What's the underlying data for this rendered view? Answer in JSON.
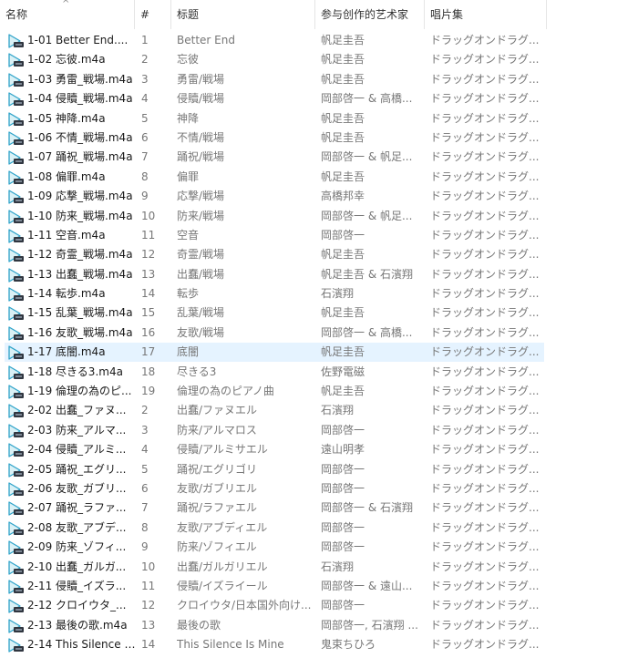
{
  "columns": {
    "name": "名称",
    "number": "#",
    "title": "标题",
    "artist": "参与创作的艺术家",
    "album": "唱片集"
  },
  "sort_indicator": "^",
  "icon": "audio-file-icon",
  "accent_color": "#e5f3ff",
  "selected_index": 16,
  "rows": [
    {
      "name": "1-01 Better End....",
      "num": "1",
      "title": "Better End",
      "artist": "帆足圭吾",
      "album": "ドラッグオンドラグ..."
    },
    {
      "name": "1-02 忘彼.m4a",
      "num": "2",
      "title": "忘彼",
      "artist": "帆足圭吾",
      "album": "ドラッグオンドラグ..."
    },
    {
      "name": "1-03 勇雷_戦場.m4a",
      "num": "3",
      "title": "勇雷/戦場",
      "artist": "帆足圭吾",
      "album": "ドラッグオンドラグ..."
    },
    {
      "name": "1-04 侵贖_戦場.m4a",
      "num": "4",
      "title": "侵贖/戦場",
      "artist": "岡部啓一 & 高橋...",
      "album": "ドラッグオンドラグ..."
    },
    {
      "name": "1-05 神降.m4a",
      "num": "5",
      "title": "神降",
      "artist": "帆足圭吾",
      "album": "ドラッグオンドラグ..."
    },
    {
      "name": "1-06 不情_戦場.m4a",
      "num": "6",
      "title": "不情/戦場",
      "artist": "帆足圭吾",
      "album": "ドラッグオンドラグ..."
    },
    {
      "name": "1-07 踊祝_戦場.m4a",
      "num": "7",
      "title": "踊祝/戦場",
      "artist": "岡部啓一 & 帆足...",
      "album": "ドラッグオンドラグ..."
    },
    {
      "name": "1-08 偏罪.m4a",
      "num": "8",
      "title": "偏罪",
      "artist": "帆足圭吾",
      "album": "ドラッグオンドラグ..."
    },
    {
      "name": "1-09 応撃_戦場.m4a",
      "num": "9",
      "title": "応撃/戦場",
      "artist": "高橋邦幸",
      "album": "ドラッグオンドラグ..."
    },
    {
      "name": "1-10 防来_戦場.m4a",
      "num": "10",
      "title": "防来/戦場",
      "artist": "岡部啓一 & 帆足...",
      "album": "ドラッグオンドラグ..."
    },
    {
      "name": "1-11 空音.m4a",
      "num": "11",
      "title": "空音",
      "artist": "岡部啓一",
      "album": "ドラッグオンドラグ..."
    },
    {
      "name": "1-12 奇霊_戦場.m4a",
      "num": "12",
      "title": "奇霊/戦場",
      "artist": "帆足圭吾",
      "album": "ドラッグオンドラグ..."
    },
    {
      "name": "1-13 出蠢_戦場.m4a",
      "num": "13",
      "title": "出蠢/戦場",
      "artist": "帆足圭吾 & 石濱翔",
      "album": "ドラッグオンドラグ..."
    },
    {
      "name": "1-14 転歩.m4a",
      "num": "14",
      "title": "転歩",
      "artist": "石濱翔",
      "album": "ドラッグオンドラグ..."
    },
    {
      "name": "1-15 乱葉_戦場.m4a",
      "num": "15",
      "title": "乱葉/戦場",
      "artist": "帆足圭吾",
      "album": "ドラッグオンドラグ..."
    },
    {
      "name": "1-16 友歌_戦場.m4a",
      "num": "16",
      "title": "友歌/戦場",
      "artist": "岡部啓一 & 高橋...",
      "album": "ドラッグオンドラグ..."
    },
    {
      "name": "1-17 底闇.m4a",
      "num": "17",
      "title": "底闇",
      "artist": "帆足圭吾",
      "album": "ドラッグオンドラグ..."
    },
    {
      "name": "1-18 尽きる3.m4a",
      "num": "18",
      "title": "尽きる3",
      "artist": "佐野電磁",
      "album": "ドラッグオンドラグ..."
    },
    {
      "name": "1-19 倫理の為のピ...",
      "num": "19",
      "title": "倫理の為のピアノ曲",
      "artist": "帆足圭吾",
      "album": "ドラッグオンドラグ..."
    },
    {
      "name": "2-02 出蠢_ファヌ...",
      "num": "2",
      "title": "出蠢/ファヌエル",
      "artist": "石濱翔",
      "album": "ドラッグオンドラグ..."
    },
    {
      "name": "2-03 防来_アルマ...",
      "num": "3",
      "title": "防来/アルマロス",
      "artist": "岡部啓一",
      "album": "ドラッグオンドラグ..."
    },
    {
      "name": "2-04 侵贖_アルミ...",
      "num": "4",
      "title": "侵贖/アルミサエル",
      "artist": "遠山明孝",
      "album": "ドラッグオンドラグ..."
    },
    {
      "name": "2-05 踊祝_エグリ...",
      "num": "5",
      "title": "踊祝/エグリゴリ",
      "artist": "岡部啓一",
      "album": "ドラッグオンドラグ..."
    },
    {
      "name": "2-06 友歌_ガブリ...",
      "num": "6",
      "title": "友歌/ガブリエル",
      "artist": "岡部啓一",
      "album": "ドラッグオンドラグ..."
    },
    {
      "name": "2-07 踊祝_ラファ...",
      "num": "7",
      "title": "踊祝/ラファエル",
      "artist": "岡部啓一 & 石濱翔",
      "album": "ドラッグオンドラグ..."
    },
    {
      "name": "2-08 友歌_アブデ...",
      "num": "8",
      "title": "友歌/アブディエル",
      "artist": "岡部啓一",
      "album": "ドラッグオンドラグ..."
    },
    {
      "name": "2-09 防来_ゾフィ...",
      "num": "9",
      "title": "防来/ゾフィエル",
      "artist": "岡部啓一",
      "album": "ドラッグオンドラグ..."
    },
    {
      "name": "2-10 出蠢_ガルガ...",
      "num": "10",
      "title": "出蠢/ガルガリエル",
      "artist": "石濱翔",
      "album": "ドラッグオンドラグ..."
    },
    {
      "name": "2-11 侵贖_イズラ...",
      "num": "11",
      "title": "侵贖/イズライール",
      "artist": "岡部啓一 & 遠山...",
      "album": "ドラッグオンドラグ..."
    },
    {
      "name": "2-12 クロイウタ_...",
      "num": "12",
      "title": "クロイウタ/日本国外向け...",
      "artist": "岡部啓一",
      "album": "ドラッグオンドラグ..."
    },
    {
      "name": "2-13 最後の歌.m4a",
      "num": "13",
      "title": "最後の歌",
      "artist": "岡部啓一, 石濱翔 ...",
      "album": "ドラッグオンドラグ..."
    },
    {
      "name": "2-14 This Silence I...",
      "num": "14",
      "title": "This Silence Is Mine",
      "artist": "鬼束ちひろ",
      "album": "ドラッグオンドラグ..."
    }
  ]
}
